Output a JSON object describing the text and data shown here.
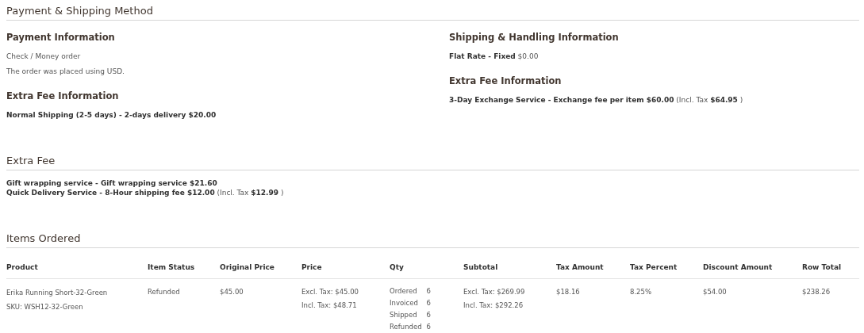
{
  "payment_shipping": {
    "title": "Payment & Shipping Method",
    "payment": {
      "heading": "Payment Information",
      "lines": [
        "Check / Money order",
        "The order was placed using USD."
      ],
      "extra_heading": "Extra Fee Information",
      "extra_lines": [
        "**Normal Shipping (2-5 days) - 2-days delivery $20.00**"
      ]
    },
    "shipping": {
      "heading": "Shipping & Handling Information",
      "lines": [
        "**Flat Rate - Fixed** $0.00"
      ],
      "extra_heading": "Extra Fee Information",
      "extra_lines": [
        "**3-Day Exchange Service - Exchange fee per item $60.00** (Incl. Tax **$64.95** )"
      ]
    }
  },
  "extra_fee": {
    "title": "Extra Fee",
    "lines": [
      "**Gift wrapping service - Gift wrapping service $21.60**",
      "**Quick Delivery Service - 8-Hour shipping fee $12.00** (Incl. Tax **$12.99** )"
    ]
  },
  "items_ordered": {
    "title": "Items Ordered",
    "columns": [
      "Product",
      "Item Status",
      "Original Price",
      "Price",
      "Qty",
      "Subtotal",
      "Tax Amount",
      "Tax Percent",
      "Discount Amount",
      "Row Total"
    ],
    "rows": [
      {
        "product": [
          "Erika Running Short-32-Green",
          "SKU: WSH12-32-Green"
        ],
        "item_status": "Refunded",
        "original_price": "$45.00",
        "price": [
          "Excl. Tax: $45.00",
          "Incl. Tax: $48.71"
        ],
        "qty": [
          {
            "label": "Ordered",
            "value": "6"
          },
          {
            "label": "Invoiced",
            "value": "6"
          },
          {
            "label": "Shipped",
            "value": "6"
          },
          {
            "label": "Refunded",
            "value": "6"
          }
        ],
        "subtotal": [
          "Excl. Tax: $269.99",
          "Incl. Tax: $292.26"
        ],
        "tax_amount": "$18.16",
        "tax_percent": "8.25%",
        "discount_amount": "$54.00",
        "row_total": "$238.26"
      }
    ]
  }
}
